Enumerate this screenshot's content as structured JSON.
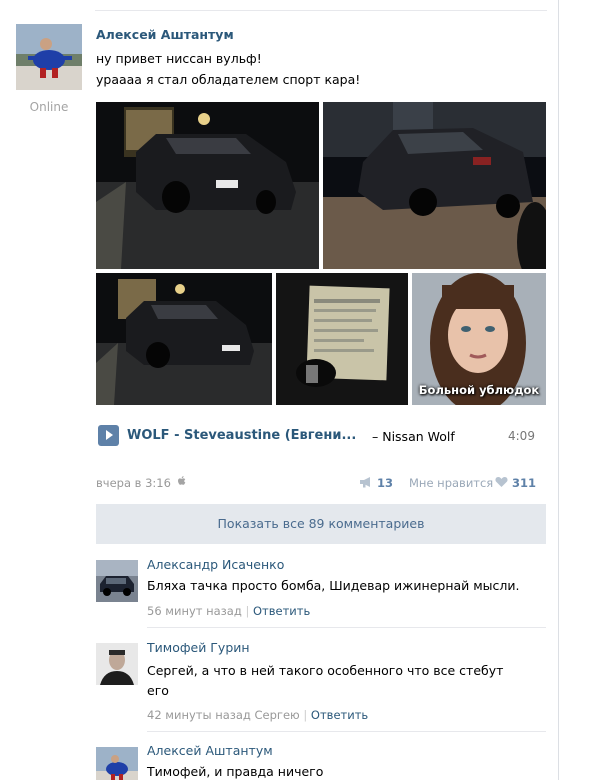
{
  "post": {
    "author": "Алексей Аштантум",
    "status": "Online",
    "text_line1": "ну привет ниссан вульф!",
    "text_line2": "урaaaa я стал обладателем спорт кара!",
    "photo_caption": "Больной ублюдок",
    "audio": {
      "artist": "WOLF - Steveaustine (Евгени...",
      "title": "– Nissan Wolf",
      "duration": "4:09"
    },
    "date": "вчера в 3:16",
    "shares": "13",
    "like_label": "Мне нравится",
    "likes": "311",
    "show_all_comments": "Показать все 89 комментариев"
  },
  "comments": [
    {
      "name": "Александр Исаченко",
      "text": "Бляха тачка просто бомба, Шидевар ижинернай мысли.",
      "time": "56 минут назад",
      "reply": "Ответить"
    },
    {
      "name": "Тимофей Гурин",
      "text_line1": "Сергей, а что в ней такого особенного что все стебут",
      "text_line2": "его",
      "time": "42 минуты назад Сергею",
      "reply": "Ответить"
    },
    {
      "name": "Алексей Аштантум",
      "text": "Тимофей, и правда ничего"
    }
  ],
  "colors": {
    "link": "#2b587a",
    "accent": "#5e81a8",
    "button_bg": "#e4e8ed"
  }
}
